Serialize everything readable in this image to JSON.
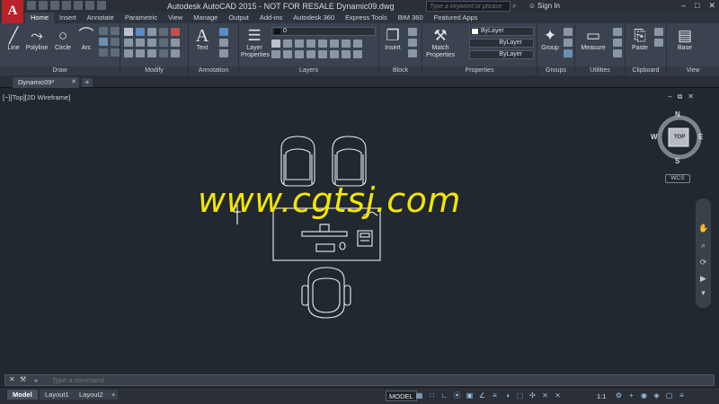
{
  "titlebar": {
    "logo": "A",
    "title": "Autodesk AutoCAD 2015 - NOT FOR RESALE    Dynamic09.dwg",
    "search_placeholder": "Type a keyword or phrase",
    "signin": "Sign In"
  },
  "tabs": [
    "Home",
    "Insert",
    "Annotate",
    "Parametric",
    "View",
    "Manage",
    "Output",
    "Add-ins",
    "Autodesk 360",
    "Express Tools",
    "BIM 360",
    "Featured Apps"
  ],
  "ribbon": {
    "draw": {
      "title": "Draw",
      "line": "Line",
      "polyline": "Polyline",
      "circle": "Circle",
      "arc": "Arc"
    },
    "modify": {
      "title": "Modify"
    },
    "annotation": {
      "title": "Annotation",
      "text": "Text"
    },
    "layers": {
      "title": "Layers",
      "layer_properties_1": "Layer",
      "layer_properties_2": "Properties",
      "current_layer": "0"
    },
    "block": {
      "title": "Block",
      "insert": "Insert"
    },
    "properties": {
      "title": "Properties",
      "match_1": "Match",
      "match_2": "Properties",
      "color": "ByLayer",
      "linetype": "ByLayer",
      "lineweight": "ByLayer"
    },
    "groups": {
      "title": "Groups",
      "group": "Group"
    },
    "utilities": {
      "title": "Utilities",
      "measure": "Measure"
    },
    "clipboard": {
      "title": "Clipboard",
      "paste": "Paste"
    },
    "view": {
      "title": "View",
      "base": "Base"
    }
  },
  "document_tab": "Dynamic09*",
  "viewport": {
    "label": "[−][Top][2D Wireframe]",
    "cube": {
      "n": "N",
      "s": "S",
      "e": "E",
      "w": "W",
      "face": "TOP"
    },
    "wcs": "WCS"
  },
  "watermark": "www.cgtsj.com",
  "command": {
    "placeholder": "Type a command",
    "prompt": "»"
  },
  "layout_tabs": [
    "Model",
    "Layout1",
    "Layout2"
  ],
  "status": {
    "model": "MODEL",
    "scale": "1:1"
  }
}
